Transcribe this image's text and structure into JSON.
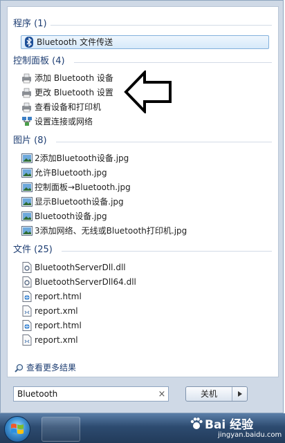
{
  "groups": {
    "programs": {
      "header": "程序 (1)",
      "items": [
        {
          "label": "Bluetooth 文件传送",
          "icon": "bluetooth-icon"
        }
      ]
    },
    "control_panel": {
      "header": "控制面板 (4)",
      "items": [
        {
          "label": "添加 Bluetooth 设备",
          "icon": "printer-device-icon"
        },
        {
          "label": "更改 Bluetooth 设置",
          "icon": "printer-device-icon"
        },
        {
          "label": "查看设备和打印机",
          "icon": "printer-device-icon"
        },
        {
          "label": "设置连接或网络",
          "icon": "network-icon"
        }
      ]
    },
    "pictures": {
      "header": "图片 (8)",
      "items": [
        {
          "label": "2添加Bluetooth设备.jpg",
          "icon": "image-file-icon"
        },
        {
          "label": "允许Bluetooth.jpg",
          "icon": "image-file-icon"
        },
        {
          "label": "控制面板→Bluetooth.jpg",
          "icon": "image-file-icon"
        },
        {
          "label": "显示Bluetooth设备.jpg",
          "icon": "image-file-icon"
        },
        {
          "label": "Bluetooth设备.jpg",
          "icon": "image-file-icon"
        },
        {
          "label": "3添加网络、无线或Bluetooth打印机.jpg",
          "icon": "image-file-icon"
        }
      ]
    },
    "files": {
      "header": "文件 (25)",
      "items": [
        {
          "label": "BluetoothServerDll.dll",
          "icon": "dll-file-icon"
        },
        {
          "label": "BluetoothServerDll64.dll",
          "icon": "dll-file-icon"
        },
        {
          "label": "report.html",
          "icon": "html-file-icon"
        },
        {
          "label": "report.xml",
          "icon": "xml-file-icon"
        },
        {
          "label": "report.html",
          "icon": "html-file-icon"
        },
        {
          "label": "report.xml",
          "icon": "xml-file-icon"
        }
      ]
    }
  },
  "see_more": "查看更多结果",
  "search": {
    "value": "Bluetooth",
    "clear_glyph": "×"
  },
  "shutdown": {
    "label": "关机",
    "arrow_glyph": "▸"
  },
  "watermark": {
    "brand": "Bai 经验",
    "sub": "jingyan.baidu.com"
  },
  "colors": {
    "header": "#1d3d72",
    "selection": "#d6e9fa",
    "taskbar": "#2d4b70"
  }
}
